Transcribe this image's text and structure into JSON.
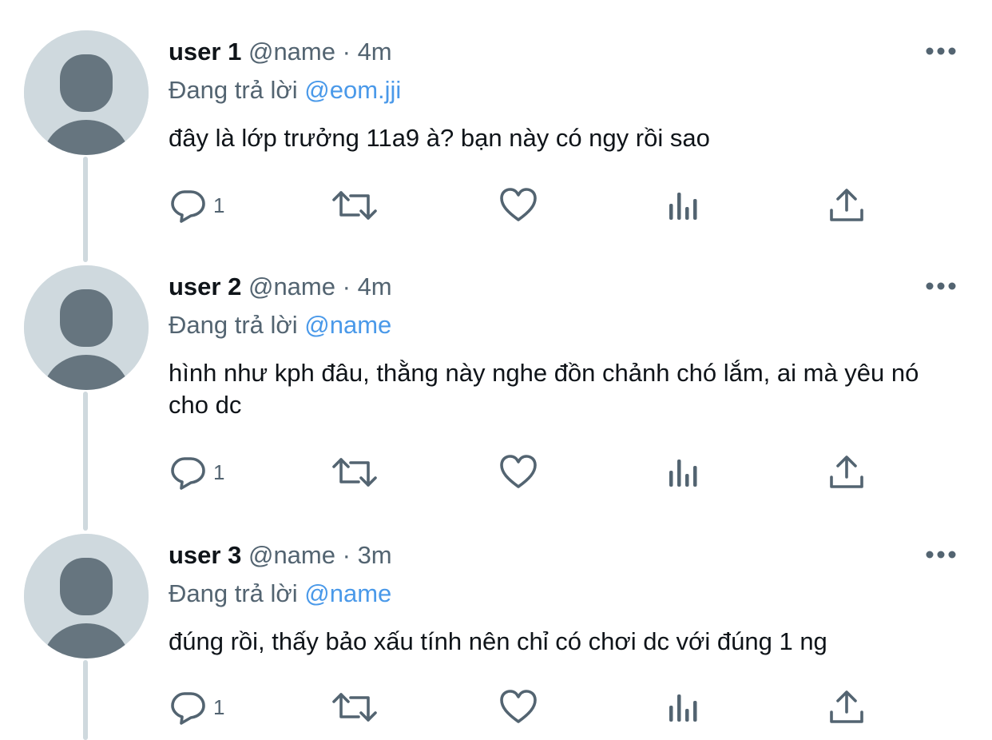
{
  "tweets": [
    {
      "display_name": "user 1",
      "handle": "@name",
      "separator": "·",
      "time": "4m",
      "replying_prefix": "Đang trả lời",
      "replying_to": "@eom.jji",
      "text": "đây là lớp trưởng 11a9 à? bạn này có ngy rồi sao",
      "reply_count": "1"
    },
    {
      "display_name": "user 2",
      "handle": "@name",
      "separator": "·",
      "time": "4m",
      "replying_prefix": "Đang trả lời",
      "replying_to": "@name",
      "text": "hình như kph đâu, thằng này nghe đồn chảnh chó lắm, ai mà yêu nó cho dc",
      "reply_count": "1"
    },
    {
      "display_name": "user 3",
      "handle": "@name",
      "separator": "·",
      "time": "3m",
      "replying_prefix": "Đang trả lời",
      "replying_to": "@name",
      "text": "đúng rồi, thấy bảo xấu tính nên chỉ có chơi dc với đúng 1 ng",
      "reply_count": "1"
    }
  ],
  "icons": {
    "reply": "reply-icon",
    "retweet": "retweet-icon",
    "like": "heart-icon",
    "views": "analytics-icon",
    "share": "share-icon",
    "more": "more-icon",
    "avatar": "default-avatar-icon"
  },
  "colors": {
    "primary_text": "#0f1419",
    "secondary_text": "#536471",
    "mention": "#4a99e9",
    "thread_line": "#cfd9de",
    "avatar_bg": "#cfd9de",
    "avatar_figure": "#66757f",
    "icon": "#536471"
  }
}
